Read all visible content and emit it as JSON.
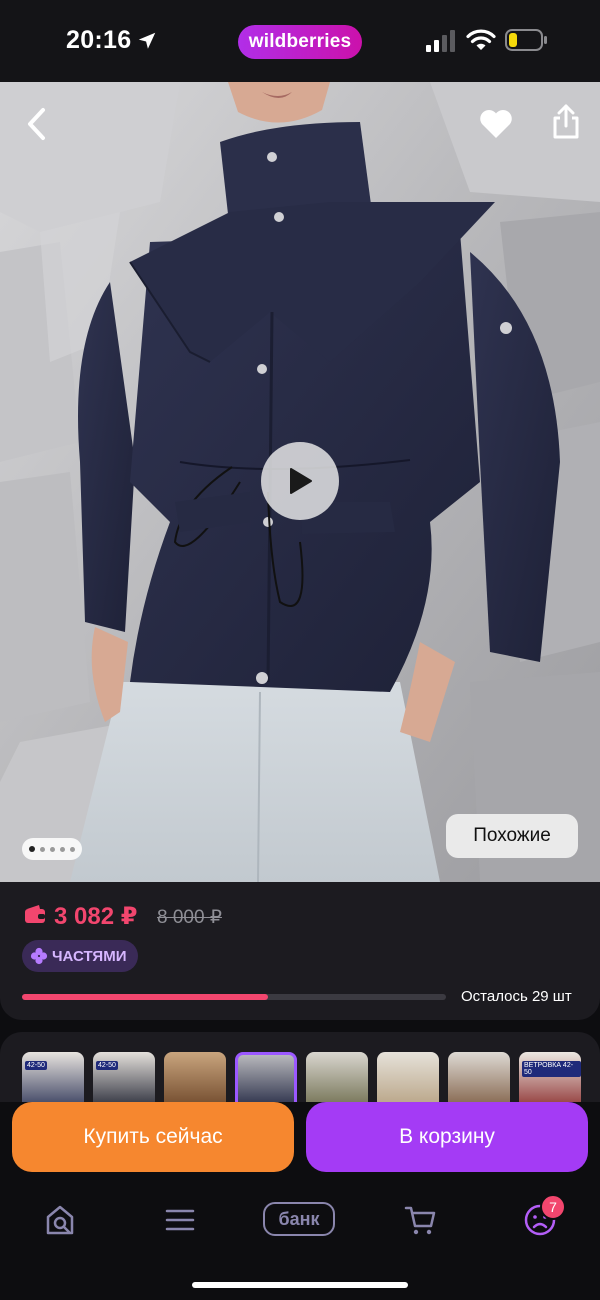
{
  "status_bar": {
    "time": "20:16",
    "brand": "wildberries"
  },
  "product_media": {
    "similar_button": "Похожие",
    "gallery_indicator": {
      "current": 1,
      "dots": 5
    },
    "icons": [
      "back-chevron-icon",
      "heart-icon",
      "share-icon",
      "play-icon"
    ]
  },
  "price": {
    "current": "3 082 ₽",
    "old": "8 000 ₽",
    "installments_label": "ЧАСТЯМИ",
    "stock_label": "Осталось 29 шт",
    "stock_progress": 0.58
  },
  "variants": {
    "thumbnails": [
      {
        "tag": "42-50",
        "selected": false
      },
      {
        "tag": "42-50",
        "selected": false
      },
      {
        "tag": "",
        "selected": false
      },
      {
        "tag": "",
        "selected": true
      },
      {
        "tag": "",
        "selected": false
      },
      {
        "tag": "",
        "selected": false
      },
      {
        "tag": "",
        "selected": false
      },
      {
        "tag": "ВЕТРОВКА 42-50",
        "selected": false
      }
    ]
  },
  "actions": {
    "buy_now": "Купить сейчас",
    "add_to_cart": "В корзину"
  },
  "tab_bar": {
    "bank": "банк",
    "profile_badge": "7",
    "icons": [
      "home-search-icon",
      "menu-icon",
      "bank-icon",
      "cart-icon",
      "profile-icon"
    ]
  },
  "colors": {
    "accent_pink": "#f2466e",
    "buy_orange": "#f6872f",
    "cart_purple": "#a43bf5",
    "brand_gradient": [
      "#b12ee8",
      "#cb11ab"
    ]
  }
}
